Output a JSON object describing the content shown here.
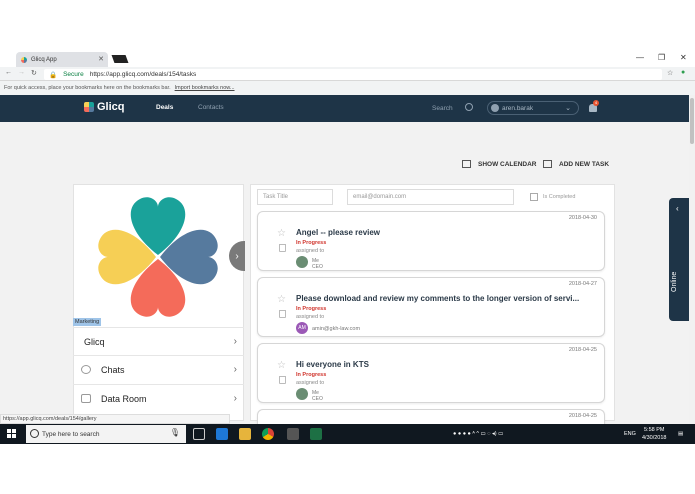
{
  "browser": {
    "tab_title": "Glicq App",
    "secure_label": "Secure",
    "url": "https://app.glicq.com/deals/154/tasks",
    "bookmarks_hint": "For quick access, place your bookmarks here on the bookmarks bar.",
    "import_link": "Import bookmarks now...",
    "status_url": "https://app.glicq.com/deals/154/gallery"
  },
  "header": {
    "logo": "Glicq",
    "nav": [
      "Deals",
      "Contacts"
    ],
    "search_label": "Search",
    "user": "aren.barak",
    "notif_count": "4"
  },
  "toolbar": {
    "show_calendar": "SHOW CALENDAR",
    "add_task": "ADD NEW TASK"
  },
  "deal": {
    "tag": "Marketing",
    "name": "Glicq",
    "items": [
      "Chats",
      "Data Room"
    ]
  },
  "filters": {
    "title_placeholder": "Task Title",
    "email_placeholder": "email@domain.com",
    "completed_label": "Is Completed"
  },
  "tasks": [
    {
      "date": "2018-04-30",
      "title": "Angel -- please review",
      "status": "In Progress",
      "assigned_label": "assigned to",
      "who": "Me",
      "role": "CEO"
    },
    {
      "date": "2018-04-27",
      "title": "Please download and review my comments to the longer version of servi...",
      "status": "In Progress",
      "assigned_label": "assigned to",
      "initials": "AM",
      "email": "amin@gkh-law.com"
    },
    {
      "date": "2018-04-25",
      "title": "Hi everyone in KTS",
      "status": "In Progress",
      "assigned_label": "assigned to",
      "who": "Me",
      "role": "CEO"
    },
    {
      "date": "2018-04-25"
    }
  ],
  "online_label": "Online",
  "taskbar": {
    "search_placeholder": "Type here to search",
    "lang": "ENG",
    "time": "5:58 PM",
    "date": "4/30/2018"
  }
}
